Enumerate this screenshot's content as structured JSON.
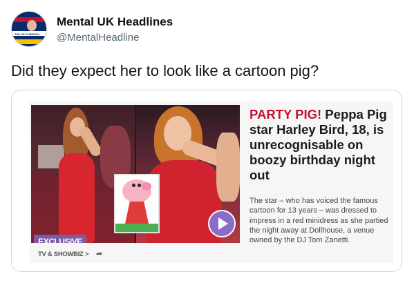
{
  "tweet": {
    "display_name": "Mental UK Headlines",
    "handle": "@MentalHeadline",
    "avatar_text": "THE UK IS MENTAL",
    "text": "Did they expect her to look like a cartoon pig?"
  },
  "article": {
    "headline_highlight": "PARTY PIG!",
    "headline_rest": " Peppa Pig star Harley Bird, 18, is unrecognisable on boozy birthday night out",
    "summary": "The star – who has voiced the famous cartoon for 13 years – was dressed to impress in a red minidress as she partied the night away at Dollhouse, a venue owned by the DJ Tom Zanetti.",
    "badge": "EXCLUSIVE",
    "section": "TV & SHOWBIZ >",
    "share_icon": "➦"
  },
  "colors": {
    "headline_accent": "#c8102e",
    "badge": "#7a5ba8",
    "play_button": "#8a6bc6"
  }
}
